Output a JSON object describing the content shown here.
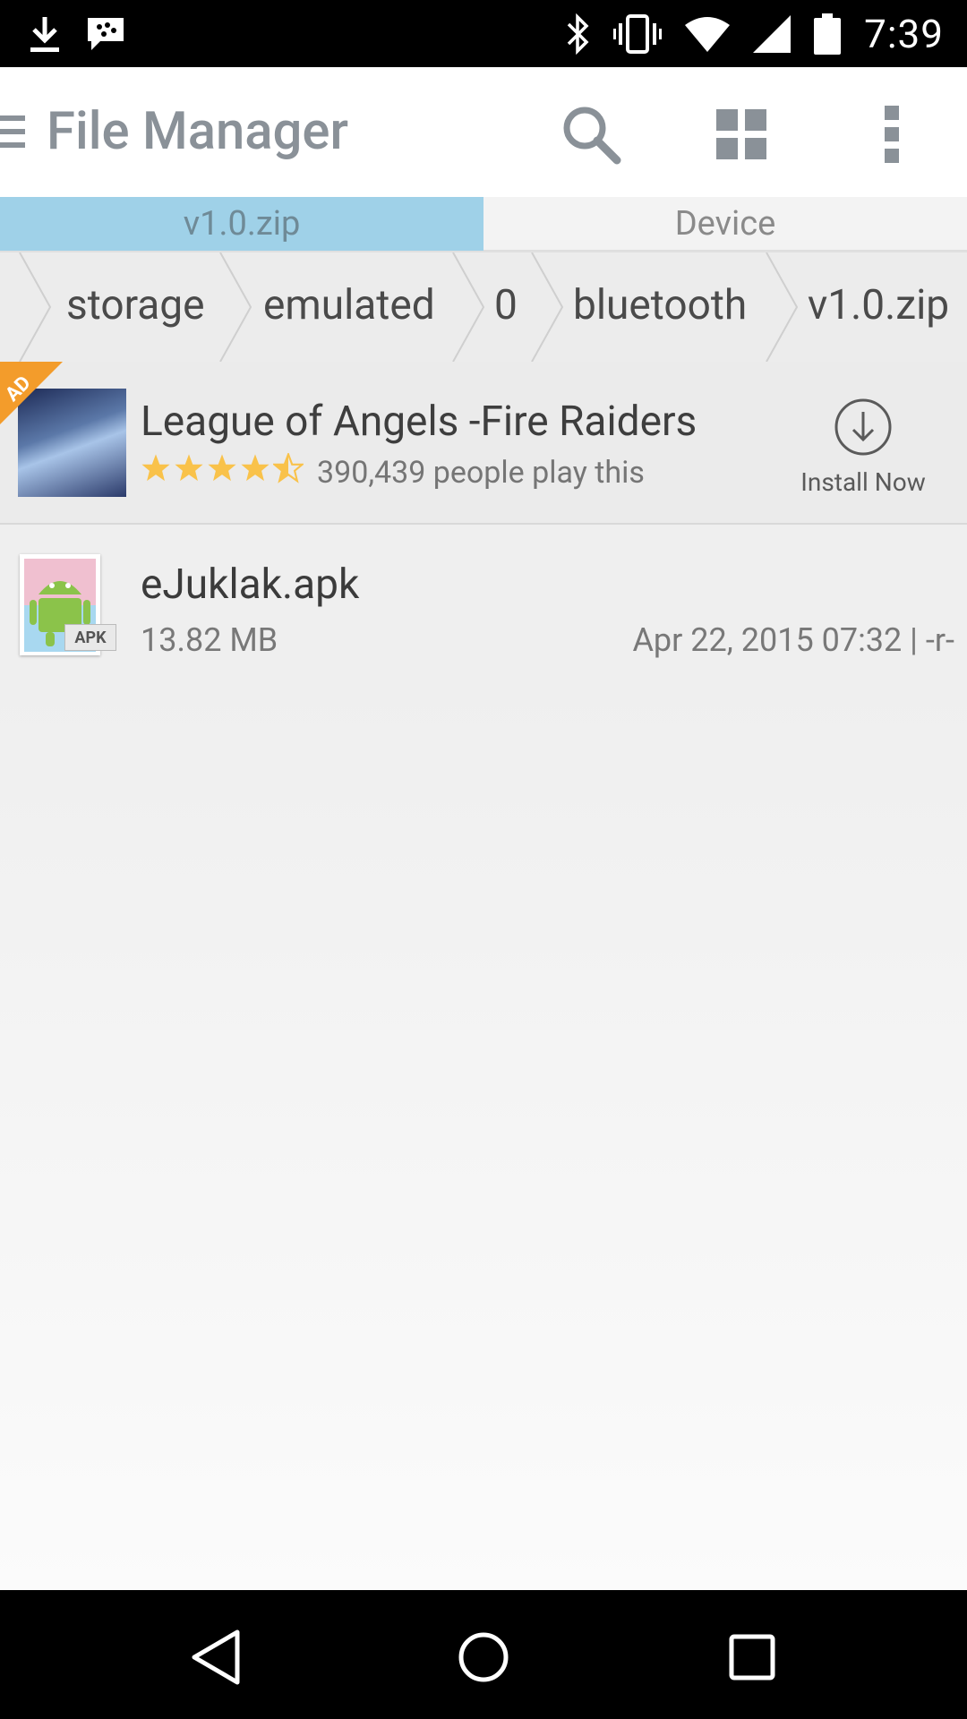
{
  "status_bar": {
    "time": "7:39",
    "left_icons": [
      "download-icon",
      "bbm-chat-icon"
    ],
    "right_icons": [
      "bluetooth-icon",
      "vibrate-icon",
      "wifi-icon",
      "signal-icon",
      "battery-icon"
    ]
  },
  "app_bar": {
    "title": "File Manager",
    "actions": [
      "search-icon",
      "grid-view-icon",
      "overflow-menu-icon"
    ]
  },
  "tabs": [
    {
      "label": "v1.0.zip",
      "active": true
    },
    {
      "label": "Device",
      "active": false
    }
  ],
  "breadcrumb": [
    "storage",
    "emulated",
    "0",
    "bluetooth",
    "v1.0.zip"
  ],
  "ad": {
    "badge": "AD",
    "title": "League of Angels -Fire Raiders",
    "rating": 4.5,
    "players": "390,439 people play this",
    "install_label": "Install Now"
  },
  "files": [
    {
      "name": "eJuklak.apk",
      "size": "13.82 MB",
      "meta": "Apr 22, 2015 07:32 | -r-",
      "badge": "APK"
    }
  ],
  "colors": {
    "active_tab": "#9fd1e8",
    "title_text": "#8a9198",
    "star": "#f9c24a",
    "ad_ribbon": "#f39c2b"
  }
}
